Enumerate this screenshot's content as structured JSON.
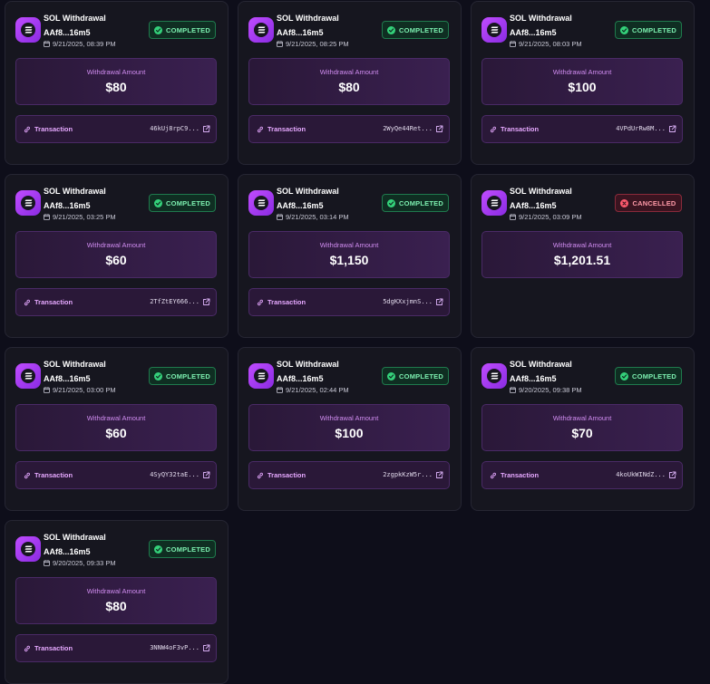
{
  "cards": [
    {
      "title": "SOL Withdrawal",
      "address": "AAf8...16m5",
      "date": "9/21/2025, 08:39 PM",
      "status": "COMPLETED",
      "status_kind": "completed",
      "amount_label": "Withdrawal Amount",
      "amount": "$80",
      "tx_label": "Transaction",
      "tx_hash": "46kUj8rpC9..."
    },
    {
      "title": "SOL Withdrawal",
      "address": "AAf8...16m5",
      "date": "9/21/2025, 08:25 PM",
      "status": "COMPLETED",
      "status_kind": "completed",
      "amount_label": "Withdrawal Amount",
      "amount": "$80",
      "tx_label": "Transaction",
      "tx_hash": "2WyQe44Ret..."
    },
    {
      "title": "SOL Withdrawal",
      "address": "AAf8...16m5",
      "date": "9/21/2025, 08:03 PM",
      "status": "COMPLETED",
      "status_kind": "completed",
      "amount_label": "Withdrawal Amount",
      "amount": "$100",
      "tx_label": "Transaction",
      "tx_hash": "4VPdUrRw8M..."
    },
    {
      "title": "SOL Withdrawal",
      "address": "AAf8...16m5",
      "date": "9/21/2025, 03:25 PM",
      "status": "COMPLETED",
      "status_kind": "completed",
      "amount_label": "Withdrawal Amount",
      "amount": "$60",
      "tx_label": "Transaction",
      "tx_hash": "2TfZtEY666..."
    },
    {
      "title": "SOL Withdrawal",
      "address": "AAf8...16m5",
      "date": "9/21/2025, 03:14 PM",
      "status": "COMPLETED",
      "status_kind": "completed",
      "amount_label": "Withdrawal Amount",
      "amount": "$1,150",
      "tx_label": "Transaction",
      "tx_hash": "5dgKXxjmnS..."
    },
    {
      "title": "SOL Withdrawal",
      "address": "AAf8...16m5",
      "date": "9/21/2025, 03:09 PM",
      "status": "CANCELLED",
      "status_kind": "cancelled",
      "amount_label": "Withdrawal Amount",
      "amount": "$1,201.51",
      "tx_label": "",
      "tx_hash": ""
    },
    {
      "title": "SOL Withdrawal",
      "address": "AAf8...16m5",
      "date": "9/21/2025, 03:00 PM",
      "status": "COMPLETED",
      "status_kind": "completed",
      "amount_label": "Withdrawal Amount",
      "amount": "$60",
      "tx_label": "Transaction",
      "tx_hash": "4SyQY32taE..."
    },
    {
      "title": "SOL Withdrawal",
      "address": "AAf8...16m5",
      "date": "9/21/2025, 02:44 PM",
      "status": "COMPLETED",
      "status_kind": "completed",
      "amount_label": "Withdrawal Amount",
      "amount": "$100",
      "tx_label": "Transaction",
      "tx_hash": "2zgpkKzW5r..."
    },
    {
      "title": "SOL Withdrawal",
      "address": "AAf8...16m5",
      "date": "9/20/2025, 09:38 PM",
      "status": "COMPLETED",
      "status_kind": "completed",
      "amount_label": "Withdrawal Amount",
      "amount": "$70",
      "tx_label": "Transaction",
      "tx_hash": "4koUkWINdZ..."
    },
    {
      "title": "SOL Withdrawal",
      "address": "AAf8...16m5",
      "date": "9/20/2025, 09:33 PM",
      "status": "COMPLETED",
      "status_kind": "completed",
      "amount_label": "Withdrawal Amount",
      "amount": "$80",
      "tx_label": "Transaction",
      "tx_hash": "3NNW4oF3vP..."
    }
  ],
  "icons": {
    "logo": "solana-logo-icon",
    "date": "calendar-icon",
    "completed": "check-circle-icon",
    "cancelled": "x-circle-icon",
    "tx": "link-icon",
    "external": "external-link-icon"
  },
  "colors": {
    "background": "#0e0e1a",
    "card": "#16161f",
    "accent": "#c04cff",
    "completed": "#34d17a",
    "cancelled": "#ff5a6e"
  }
}
